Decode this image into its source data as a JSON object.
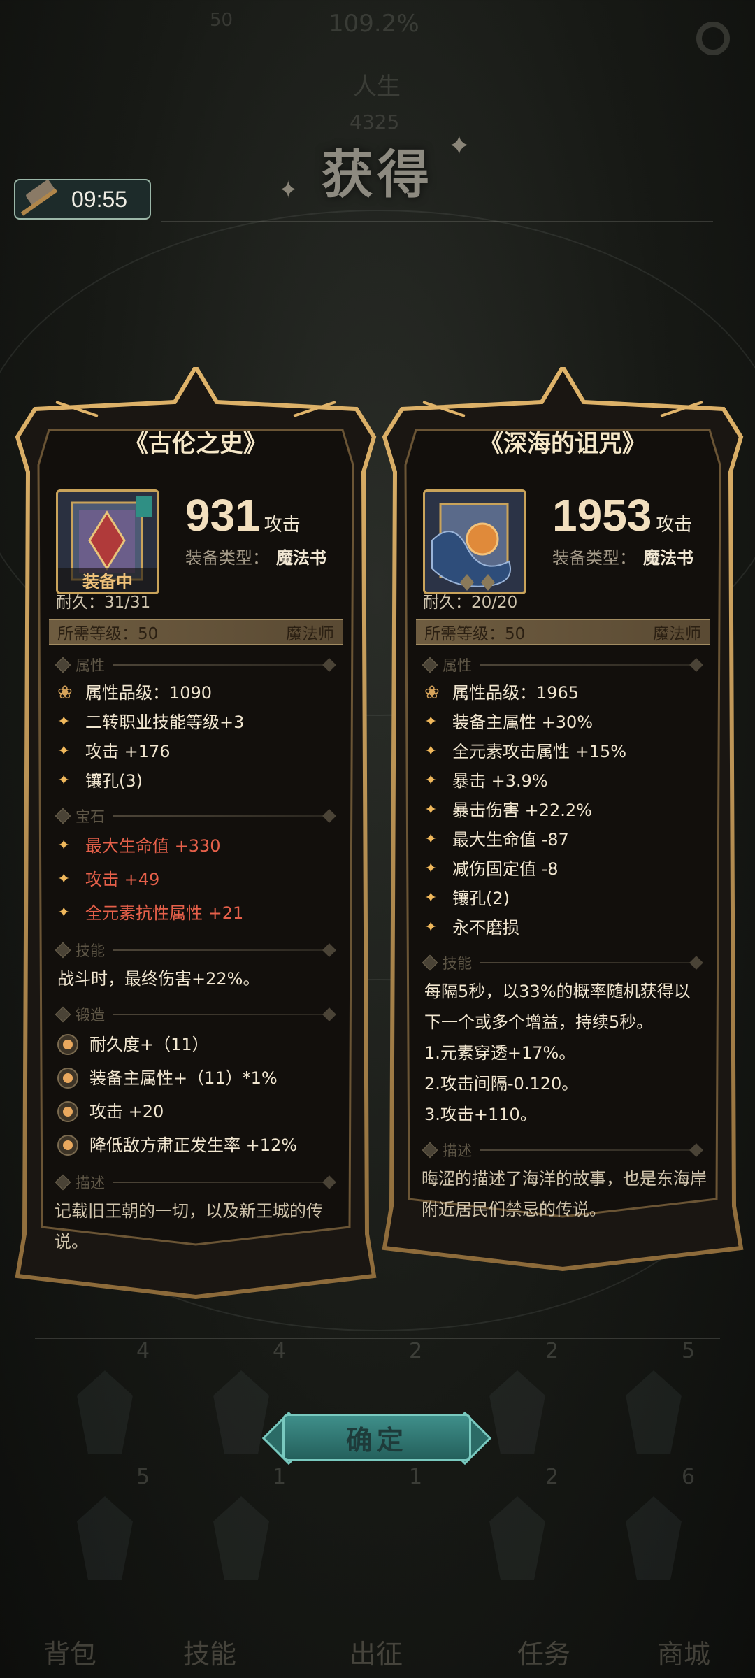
{
  "background": {
    "top_value": "109.2%",
    "top_left": "50",
    "center_label": "人生",
    "center_value": "4325",
    "nums_row1": [
      "4",
      "4",
      "2",
      "2",
      "5"
    ],
    "nums_row2": [
      "5",
      "1",
      "1",
      "2",
      "6"
    ],
    "bottom_nav": [
      "背包",
      "技能",
      "出征",
      "任务",
      "商城"
    ]
  },
  "title": "获得",
  "timer": {
    "time": "09:55"
  },
  "cards": [
    {
      "name": "《古伦之史》",
      "power": "931",
      "power_unit": "攻击",
      "type_label": "装备类型：",
      "type_value": "魔法书",
      "equipped_label": "装备中",
      "durability": "耐久：31/31",
      "req_level": "所需等级：50",
      "req_class": "魔法师",
      "attr_head": "属性",
      "quality": "属性品级：1090",
      "attrs": [
        "二转职业技能等级+3",
        "攻击 +176",
        "镶孔(3)"
      ],
      "gem_head": "宝石",
      "gems": [
        "最大生命值 +330",
        "攻击 +49",
        "全元素抗性属性 +21"
      ],
      "skill_head": "技能",
      "skill_text": "战斗时，最终伤害+22%。",
      "forge_head": "锻造",
      "forge": [
        "耐久度+（11）",
        "装备主属性+（11）*1%",
        "攻击 +20",
        "降低敌方肃正发生率 +12%"
      ],
      "desc_head": "描述",
      "desc": "记载旧王朝的一切，以及新王城的传说。",
      "icon": "spellbook-icon"
    },
    {
      "name": "《深海的诅咒》",
      "power": "1953",
      "power_unit": "攻击",
      "type_label": "装备类型：",
      "type_value": "魔法书",
      "durability": "耐久：20/20",
      "req_level": "所需等级：50",
      "req_class": "魔法师",
      "attr_head": "属性",
      "quality": "属性品级：1965",
      "attrs": [
        "装备主属性 +30%",
        "全元素攻击属性 +15%",
        "暴击 +3.9%",
        "暴击伤害 +22.2%",
        "最大生命值 -87",
        "减伤固定值 -8",
        "镶孔(2)",
        "永不磨损"
      ],
      "skill_head": "技能",
      "skill_lines": [
        "每隔5秒，以33%的概率随机获得以下一个或多个增益，持续5秒。",
        "1.元素穿透+17%。",
        "2.攻击间隔-0.120。",
        "3.攻击+110。"
      ],
      "desc_head": "描述",
      "desc": "晦涩的描述了海洋的故事，也是东海岸附近居民们禁忌的传说。",
      "icon": "deep-sea-tome-icon"
    }
  ],
  "confirm_label": "确定"
}
